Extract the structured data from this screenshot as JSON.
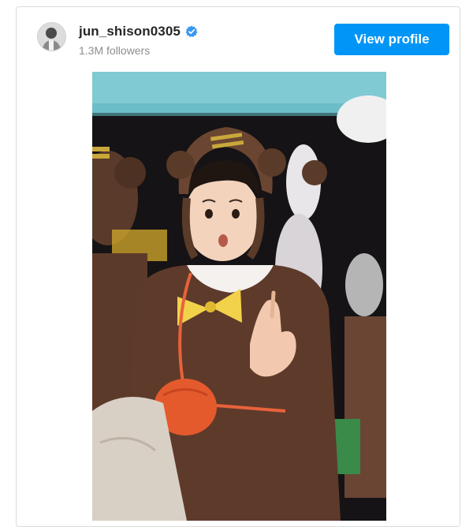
{
  "post": {
    "username": "jun_shison0305",
    "verified": true,
    "followers": "1.3M followers",
    "view_profile_label": "View profile"
  },
  "icons": {
    "avatar": "profile-avatar",
    "verified": "verified-badge-icon"
  },
  "colors": {
    "button": "#0095f6",
    "verified": "#3897f0",
    "username": "#262626",
    "followers": "#8e8e8e"
  }
}
